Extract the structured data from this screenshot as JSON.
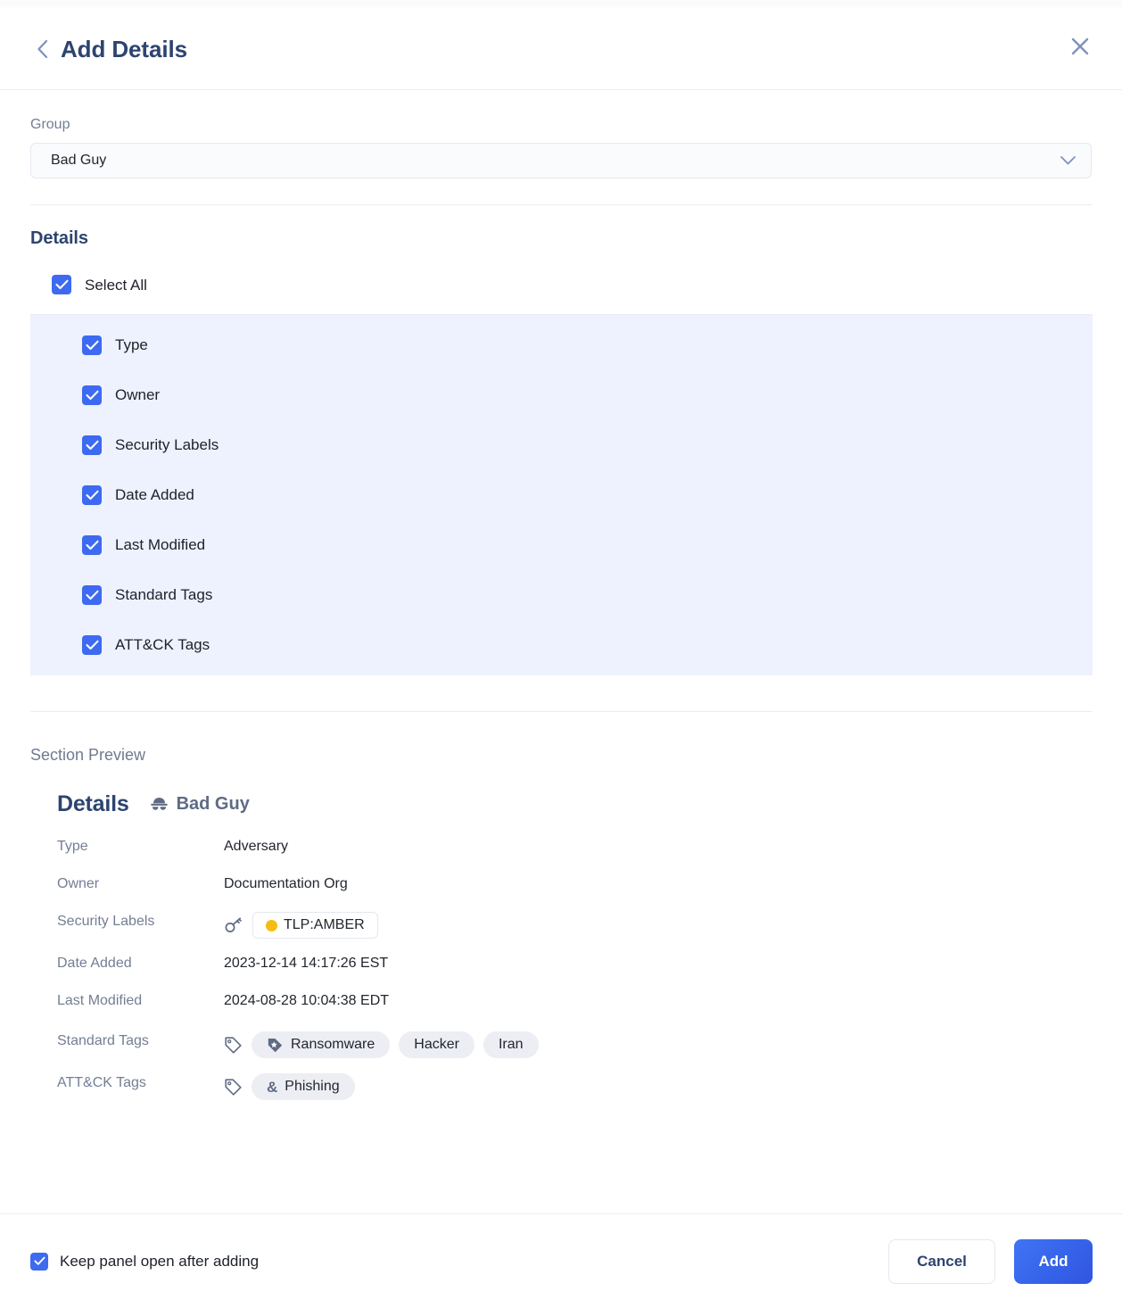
{
  "header": {
    "title": "Add Details",
    "back_icon": "chevron-left-icon",
    "close_icon": "close-icon"
  },
  "group": {
    "label": "Group",
    "value": "Bad Guy",
    "caret_icon": "chevron-down-icon"
  },
  "details": {
    "section_title": "Details",
    "select_all_label": "Select All",
    "select_all_checked": true,
    "options": [
      {
        "label": "Type",
        "checked": true
      },
      {
        "label": "Owner",
        "checked": true
      },
      {
        "label": "Security Labels",
        "checked": true
      },
      {
        "label": "Date Added",
        "checked": true
      },
      {
        "label": "Last Modified",
        "checked": true
      },
      {
        "label": "Standard Tags",
        "checked": true
      },
      {
        "label": "ATT&CK Tags",
        "checked": true
      }
    ]
  },
  "preview": {
    "label": "Section Preview",
    "title": "Details",
    "group_name": "Bad Guy",
    "group_icon": "spy-icon",
    "rows": {
      "type": {
        "key": "Type",
        "value": "Adversary"
      },
      "owner": {
        "key": "Owner",
        "value": "Documentation Org"
      },
      "security_labels": {
        "key": "Security Labels",
        "icon": "key-icon",
        "chip_label": "TLP:AMBER",
        "chip_dot_color": "#f5bc12"
      },
      "date_added": {
        "key": "Date Added",
        "value": "2023-12-14 14:17:26 EST"
      },
      "last_modified": {
        "key": "Last Modified",
        "value": "2024-08-28 10:04:38 EDT"
      },
      "standard_tags": {
        "key": "Standard Tags",
        "icon": "tag-outline-icon",
        "tags": [
          "Ransomware",
          "Hacker",
          "Iran"
        ]
      },
      "attck_tags": {
        "key": "ATT&CK Tags",
        "icon": "tag-outline-icon",
        "tags": [
          "Phishing"
        ],
        "tag_glyph": "&"
      }
    }
  },
  "footer": {
    "keep_open_label": "Keep panel open after adding",
    "keep_open_checked": true,
    "cancel_label": "Cancel",
    "add_label": "Add"
  },
  "colors": {
    "accent": "#3d6af0",
    "title": "#2d4470",
    "muted": "#737e95",
    "highlight_bg": "#edf2fe",
    "amber": "#f5bc12"
  }
}
